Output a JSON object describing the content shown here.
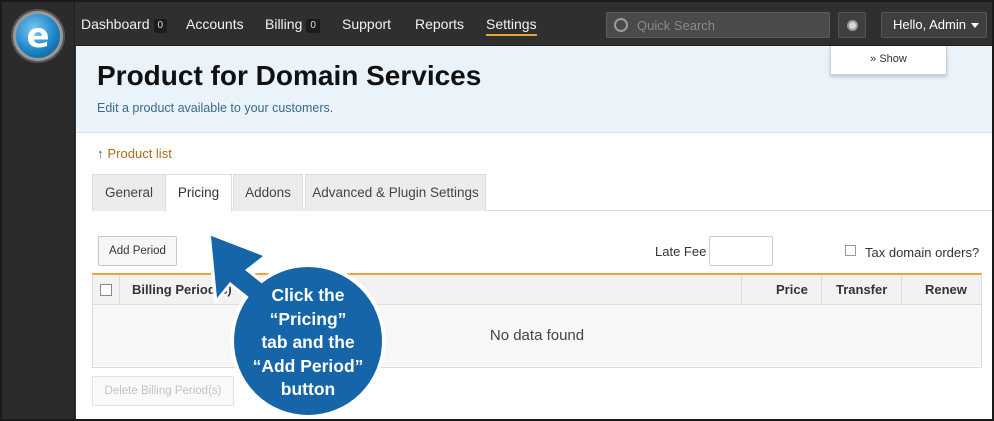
{
  "nav": {
    "items": [
      {
        "label": "Dashboard",
        "badge": "0"
      },
      {
        "label": "Accounts"
      },
      {
        "label": "Billing",
        "badge": "0"
      },
      {
        "label": "Support"
      },
      {
        "label": "Reports"
      },
      {
        "label": "Settings",
        "active": true
      }
    ],
    "search_placeholder": "Quick Search",
    "user_label": "Hello, Admin",
    "logo_letter": "e"
  },
  "header": {
    "show_label": "» Show",
    "title": "Product for Domain Services",
    "subtitle": "Edit a product available to your customers."
  },
  "breadcrumb": {
    "icon": "↑",
    "label": "Product list"
  },
  "tabs": [
    {
      "label": "General"
    },
    {
      "label": "Pricing",
      "active": true
    },
    {
      "label": "Addons"
    },
    {
      "label": "Advanced & Plugin Settings"
    }
  ],
  "toolbar": {
    "add_period": "Add Period",
    "late_fee_label": "Late Fee",
    "late_fee_value": "",
    "tax_label": "Tax domain orders?"
  },
  "table": {
    "columns": [
      "Billing Period(s)",
      "Price",
      "Transfer",
      "Renew"
    ],
    "empty_text": "No data found"
  },
  "footer": {
    "delete_label": "Delete Billing Period(s)"
  },
  "callout": {
    "lines": [
      "Click the",
      "“Pricing”",
      "tab and the",
      "“Add Period”",
      "button"
    ],
    "color": "#1565a8"
  },
  "colors": {
    "accent": "#f0a23a",
    "link": "#b06a1a",
    "subtitle": "#3a6a8a",
    "header_bg": "#eaf2fa"
  }
}
